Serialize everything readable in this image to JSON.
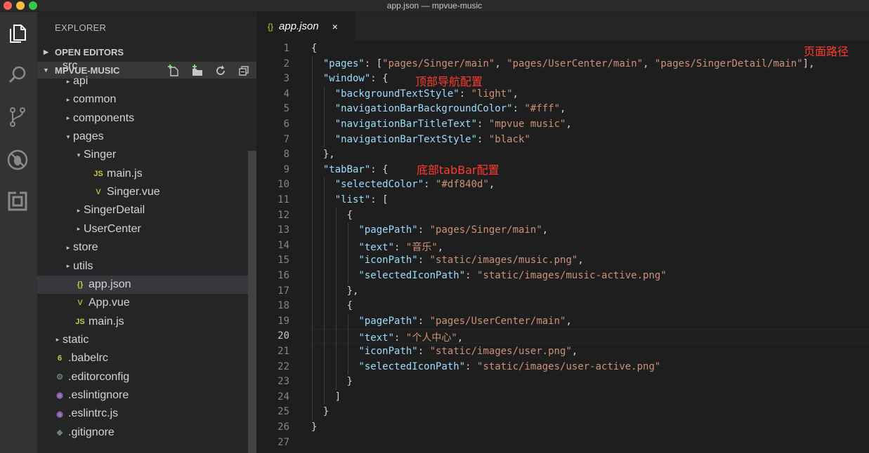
{
  "window": {
    "title": "app.json — mpvue-music"
  },
  "activity_bar": [
    "files-icon",
    "search-icon",
    "source-control-icon",
    "debug-icon",
    "extensions-icon"
  ],
  "sidebar": {
    "title": "EXPLORER",
    "open_editors": "OPEN EDITORS",
    "project": "MPVUE-MUSIC",
    "tree": [
      {
        "label": "src",
        "twisty": "",
        "icon": "",
        "depth": 1
      },
      {
        "label": "api",
        "twisty": "▸",
        "icon": "",
        "depth": 2
      },
      {
        "label": "common",
        "twisty": "▸",
        "icon": "",
        "depth": 2
      },
      {
        "label": "components",
        "twisty": "▸",
        "icon": "",
        "depth": 2
      },
      {
        "label": "pages",
        "twisty": "▾",
        "icon": "",
        "depth": 2
      },
      {
        "label": "Singer",
        "twisty": "▾",
        "icon": "",
        "depth": 3
      },
      {
        "label": "main.js",
        "twisty": "",
        "icon": "JS",
        "depth": 4
      },
      {
        "label": "Singer.vue",
        "twisty": "",
        "icon": "V",
        "depth": 4
      },
      {
        "label": "SingerDetail",
        "twisty": "▸",
        "icon": "",
        "depth": 3
      },
      {
        "label": "UserCenter",
        "twisty": "▸",
        "icon": "",
        "depth": 3
      },
      {
        "label": "store",
        "twisty": "▸",
        "icon": "",
        "depth": 2
      },
      {
        "label": "utils",
        "twisty": "▸",
        "icon": "",
        "depth": 2
      },
      {
        "label": "app.json",
        "twisty": "",
        "icon": "{}",
        "depth": 2,
        "selected": true
      },
      {
        "label": "App.vue",
        "twisty": "",
        "icon": "V",
        "depth": 2
      },
      {
        "label": "main.js",
        "twisty": "",
        "icon": "JS",
        "depth": 2
      },
      {
        "label": "static",
        "twisty": "▸",
        "icon": "",
        "depth": 1
      },
      {
        "label": ".babelrc",
        "twisty": "",
        "icon": "6",
        "depth": 1
      },
      {
        "label": ".editorconfig",
        "twisty": "",
        "icon": "⚙",
        "depth": 1
      },
      {
        "label": ".eslintignore",
        "twisty": "",
        "icon": "◉",
        "depth": 1
      },
      {
        "label": ".eslintrc.js",
        "twisty": "",
        "icon": "◉",
        "depth": 1
      },
      {
        "label": ".gitignore",
        "twisty": "",
        "icon": "◆",
        "depth": 1
      }
    ]
  },
  "tab": {
    "braces": "{}",
    "name": "app.json",
    "close": "×"
  },
  "editor": {
    "current_line": 20,
    "lines": [
      "{",
      "  \"pages\": [\"pages/Singer/main\", \"pages/UserCenter/main\", \"pages/SingerDetail/main\"],",
      "  \"window\": {",
      "    \"backgroundTextStyle\": \"light\",",
      "    \"navigationBarBackgroundColor\": \"#fff\",",
      "    \"navigationBarTitleText\": \"mpvue music\",",
      "    \"navigationBarTextStyle\": \"black\"",
      "  },",
      "  \"tabBar\": {",
      "    \"selectedColor\": \"#df840d\",",
      "    \"list\": [",
      "      {",
      "        \"pagePath\": \"pages/Singer/main\",",
      "        \"text\": \"音乐\",",
      "        \"iconPath\": \"static/images/music.png\",",
      "        \"selectedIconPath\": \"static/images/music-active.png\"",
      "      },",
      "      {",
      "        \"pagePath\": \"pages/UserCenter/main\",",
      "        \"text\": \"个人中心\",",
      "        \"iconPath\": \"static/images/user.png\",",
      "        \"selectedIconPath\": \"static/images/user-active.png\"",
      "      }",
      "    ]",
      "  }",
      "}",
      ""
    ]
  },
  "annotations": {
    "pages": "页面路径",
    "window": "顶部导航配置",
    "tabbar": "底部tabBar配置"
  },
  "colors": {
    "key": "#9cdcfe",
    "string": "#ce9178",
    "annotation": "#ff3b30"
  }
}
